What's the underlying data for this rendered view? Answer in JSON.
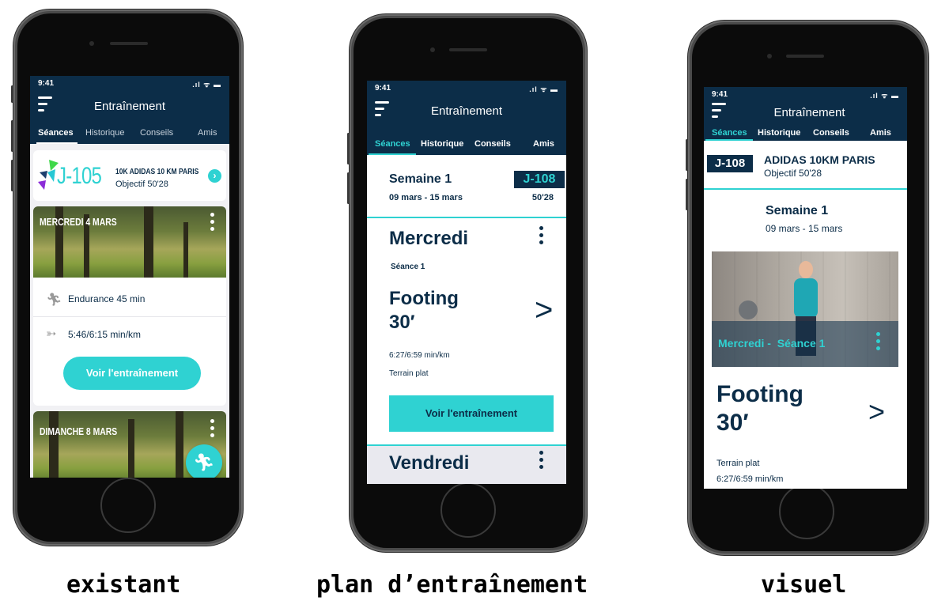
{
  "status_time": "9:41",
  "status_icons": ".ıl ᯤ ▬",
  "app_title": "Entraînement",
  "tabs": [
    "Séances",
    "Historique",
    "Conseils",
    "Amis"
  ],
  "colors": {
    "navy": "#0c2d48",
    "accent": "#2fd2d2",
    "light_gray": "#e9e9ef"
  },
  "phone1": {
    "countdown": "J-105",
    "race": "10K ADIDAS 10 KM PARIS",
    "goal": "Objectif 50'28",
    "session1": {
      "date": "MERCREDI 4 MARS",
      "activity": "Endurance 45 min",
      "pace": "5:46/6:15 min/km",
      "button": "Voir l'entraînement"
    },
    "session2": {
      "date": "DIMANCHE 8 MARS"
    }
  },
  "phone2": {
    "week_title": "Semaine 1",
    "week_dates": "09 mars - 15 mars",
    "countdown": "J-108",
    "goal_time": "50'28",
    "day": "Mercredi",
    "session_label": "Séance 1",
    "workout_line1": "Footing",
    "workout_line2": "30′",
    "pace": "6:27/6:59 min/km",
    "terrain": "Terrain plat",
    "button": "Voir l'entraînement",
    "next_day": "Vendredi"
  },
  "phone3": {
    "countdown": "J-108",
    "race": "ADIDAS 10KM PARIS",
    "goal": "Objectif 50'28",
    "week_title": "Semaine 1",
    "week_dates": "09 mars - 15 mars",
    "session_overlay": "Mercredi -  Séance 1",
    "workout_line1": "Footing",
    "workout_line2": "30′",
    "terrain": "Terrain plat",
    "pace": "6:27/6:59 min/km"
  },
  "captions": [
    "existant",
    "plan d’entraînement",
    "visuel"
  ]
}
